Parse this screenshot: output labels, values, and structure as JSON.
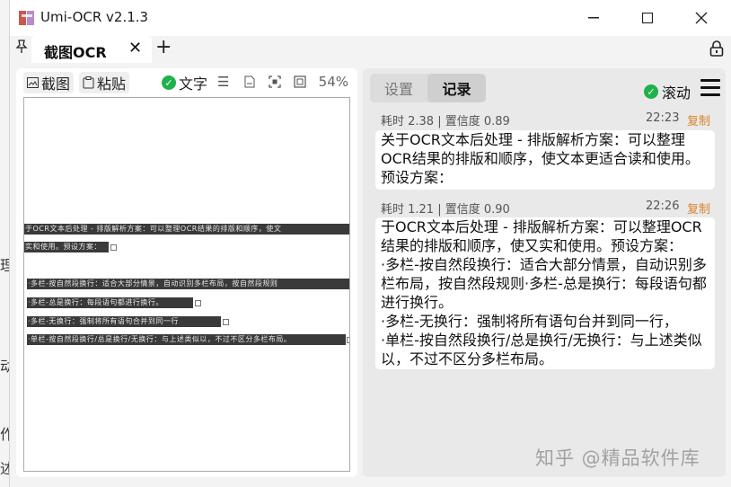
{
  "window": {
    "title": "Umi-OCR v2.1.3"
  },
  "tabs": {
    "active_label": "截图OCR",
    "add": "+"
  },
  "left_toolbar": {
    "screenshot": "截图",
    "paste": "粘贴",
    "text_label": "文字",
    "zoom": "54%"
  },
  "ocr_lines": [
    "于OCR文本后处理 - 排版解析方案：可以整理OCR结果的排版和顺序，使文",
    "实和使用。预设方案：",
    "·多栏-按自然段换行：适合大部分情景，自动识别多栏布局，按自然段规则",
    "·多栏-总是换行：每段语句都进行换行。",
    "·多栏-无换行：强制将所有语句合并到同一行",
    "·单栏-按自然段换行/总是换行/无换行：与上述类似以，不过不区分多栏布局。"
  ],
  "right_panel": {
    "tab_settings": "设置",
    "tab_records": "记录",
    "scroll_label": "滚动",
    "records": [
      {
        "meta": "耗时 2.38 | 置信度 0.89",
        "time": "22:23",
        "copy": "复制",
        "text": "关于OCR文本后处理 - 排版解析方案：可以整理\nOCR结果的排版和顺序，使文本更适合读和使用。\n预设方案："
      },
      {
        "meta": "耗时 1.21 | 置信度 0.90",
        "time": "22:26",
        "copy": "复制",
        "text": "于OCR文本后处理 - 排版解析方案：可以整理OCR\n结果的排版和顺序，使又实和使用。预设方案：\n·多栏-按自然段换行：适合大部分情景，自动识别多\n栏布局，按自然段规则·多栏-总是换行：每段语句都\n进行换行。\n·多栏-无换行：强制将所有语句台并到同一行，\n·单栏-按自然段换行/总是换行/无换行：与上述类似\n以，不过不区分多栏布局。"
      }
    ]
  },
  "watermark": "知乎 @精品软件库",
  "background_fragments": [
    "理",
    "动",
    "作",
    "述"
  ],
  "colors": {
    "accent_check": "#1fb14a",
    "copy_link": "#d9822b",
    "ocr_box": "#3a3a3a"
  }
}
